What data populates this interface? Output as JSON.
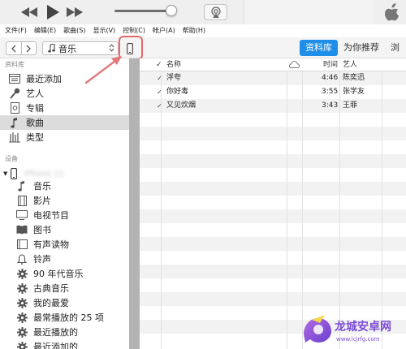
{
  "menu": [
    "文件(F)",
    "编辑(E)",
    "歌曲(S)",
    "显示(V)",
    "控制(C)",
    "帐户(A)",
    "帮助(H)"
  ],
  "navbar": {
    "media_select": "音乐",
    "tabs": [
      {
        "label": "资料库",
        "active": true
      },
      {
        "label": "为你推荐",
        "active": false
      },
      {
        "label": "浏",
        "active": false
      }
    ]
  },
  "sidebar": {
    "library_title": "资料库",
    "library_items": [
      {
        "label": "最近添加",
        "icon": "recently-added-icon",
        "selected": false
      },
      {
        "label": "艺人",
        "icon": "artist-icon",
        "selected": false
      },
      {
        "label": "专辑",
        "icon": "album-icon",
        "selected": false
      },
      {
        "label": "歌曲",
        "icon": "music-note-icon",
        "selected": true
      },
      {
        "label": "类型",
        "icon": "genre-icon",
        "selected": false
      }
    ],
    "devices_title": "设备",
    "device_name": "iPhone 11",
    "device_items": [
      {
        "label": "音乐",
        "icon": "music-note-icon"
      },
      {
        "label": "影片",
        "icon": "film-icon"
      },
      {
        "label": "电视节目",
        "icon": "tv-icon"
      },
      {
        "label": "图书",
        "icon": "book-icon"
      },
      {
        "label": "有声读物",
        "icon": "audiobook-icon"
      },
      {
        "label": "铃声",
        "icon": "bell-icon"
      },
      {
        "label": "90 年代音乐",
        "icon": "gear-icon"
      },
      {
        "label": "古典音乐",
        "icon": "gear-icon"
      },
      {
        "label": "我的最爱",
        "icon": "gear-icon"
      },
      {
        "label": "最常播放的 25 项",
        "icon": "gear-icon"
      },
      {
        "label": "最近播放的",
        "icon": "gear-icon"
      },
      {
        "label": "最近添加的",
        "icon": "gear-icon"
      }
    ]
  },
  "table": {
    "check_header": "✓",
    "columns": {
      "name": "名称",
      "time": "时间",
      "artist": "艺人"
    },
    "rows": [
      {
        "name": "浮夸",
        "time": "4:46",
        "artist": "陈奕迅"
      },
      {
        "name": "你好毒",
        "time": "3:55",
        "artist": "张学友"
      },
      {
        "name": "又见炊烟",
        "time": "3:43",
        "artist": "王菲"
      }
    ]
  },
  "watermark": {
    "text": "龙城安卓网",
    "url": "www.lcjrfg.com"
  },
  "colors": {
    "accent": "#1e8ee8",
    "highlight_box": "#e26a6a",
    "annotation_arrow": "#e07a7a"
  }
}
